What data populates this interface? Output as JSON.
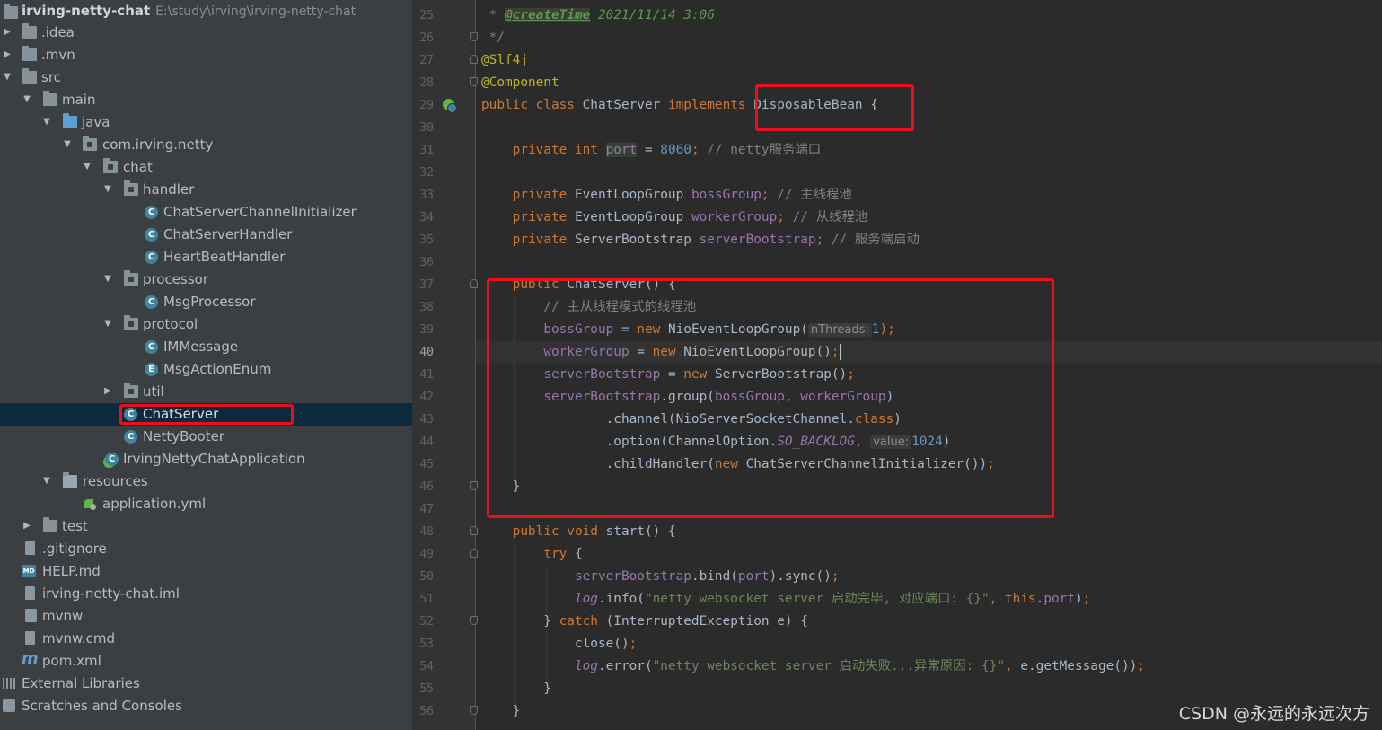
{
  "project_tree": {
    "root": {
      "name": "irving-netty-chat",
      "path": "E:\\study\\irving\\irving-netty-chat"
    },
    "items": [
      {
        "label": ".idea"
      },
      {
        "label": ".mvn"
      },
      {
        "label": "src"
      },
      {
        "label": "main"
      },
      {
        "label": "java"
      },
      {
        "label": "com.irving.netty"
      },
      {
        "label": "chat"
      },
      {
        "label": "handler"
      },
      {
        "label": "ChatServerChannelInitializer",
        "icon_letter": "C"
      },
      {
        "label": "ChatServerHandler",
        "icon_letter": "C"
      },
      {
        "label": "HeartBeatHandler",
        "icon_letter": "C"
      },
      {
        "label": "processor"
      },
      {
        "label": "MsgProcessor",
        "icon_letter": "C"
      },
      {
        "label": "protocol"
      },
      {
        "label": "IMMessage",
        "icon_letter": "C"
      },
      {
        "label": "MsgActionEnum",
        "icon_letter": "E"
      },
      {
        "label": "util"
      },
      {
        "label": "ChatServer",
        "icon_letter": "C"
      },
      {
        "label": "NettyBooter",
        "icon_letter": "C"
      },
      {
        "label": "IrvingNettyChatApplication",
        "icon_letter": "C"
      },
      {
        "label": "resources"
      },
      {
        "label": "application.yml"
      },
      {
        "label": "test"
      },
      {
        "label": ".gitignore"
      },
      {
        "label": "HELP.md",
        "icon_letter": "MD"
      },
      {
        "label": "irving-netty-chat.iml"
      },
      {
        "label": "mvnw"
      },
      {
        "label": "mvnw.cmd"
      },
      {
        "label": "pom.xml",
        "icon_letter": "m"
      },
      {
        "label": "External Libraries"
      },
      {
        "label": "Scratches and Consoles"
      }
    ]
  },
  "editor": {
    "current_line": 40,
    "line_numbers": [
      "25",
      "26",
      "27",
      "28",
      "29",
      "30",
      "31",
      "32",
      "33",
      "34",
      "35",
      "36",
      "37",
      "38",
      "39",
      "40",
      "41",
      "42",
      "43",
      "44",
      "45",
      "46",
      "47",
      "48",
      "49",
      "50",
      "51",
      "52",
      "53",
      "54",
      "55",
      "56"
    ],
    "code": {
      "l25": {
        "a": " * ",
        "b": "@createTime",
        "c": " 2021/11/14 3:06"
      },
      "l26": " */",
      "l27": "@Slf4j",
      "l28": "@Component",
      "l29": {
        "a": "public class ",
        "b": "ChatServer ",
        "c": "implements ",
        "d": "DisposableBean {"
      },
      "l31": {
        "a": "    private int ",
        "b": "port",
        "c": " = ",
        "d": "8060",
        "e": "; ",
        "f": "// netty服务端口"
      },
      "l33": {
        "a": "    private ",
        "b": "EventLoopGroup ",
        "c": "bossGroup",
        "d": "; ",
        "e": "// 主线程池"
      },
      "l34": {
        "a": "    private ",
        "b": "EventLoopGroup ",
        "c": "workerGroup",
        "d": "; ",
        "e": "// 从线程池"
      },
      "l35": {
        "a": "    private ",
        "b": "ServerBootstrap ",
        "c": "serverBootstrap",
        "d": "; ",
        "e": "// 服务端启动"
      },
      "l37": {
        "a": "    public ",
        "b": "ChatServer() {"
      },
      "l38": "        // 主从线程模式的线程池",
      "l39": {
        "a": "        ",
        "b": "bossGroup",
        "c": " = ",
        "d": "new ",
        "e": "NioEventLoopGroup(",
        "hint": "nThreads:",
        "f": "1",
        "g": ");"
      },
      "l40": {
        "a": "        ",
        "b": "workerGroup",
        "c": " = ",
        "d": "new ",
        "e": "NioEventLoopGroup()",
        "f": ";"
      },
      "l41": {
        "a": "        ",
        "b": "serverBootstrap",
        "c": " = ",
        "d": "new ",
        "e": "ServerBootstrap()",
        "f": ";"
      },
      "l42": {
        "a": "        ",
        "b": "serverBootstrap",
        "c": ".group(",
        "d": "bossGroup",
        "e": ", ",
        "f": "workerGroup",
        "g": ")"
      },
      "l43": {
        "a": "                .channel(NioServerSocketChannel.",
        "b": "class",
        "c": ")"
      },
      "l44": {
        "a": "                .option(ChannelOption.",
        "b": "SO_BACKLOG",
        "c": ", ",
        "hint": "value:",
        "d": "1024",
        "e": ")"
      },
      "l45": {
        "a": "                .childHandler(",
        "b": "new ",
        "c": "ChatServerChannelInitializer())",
        "d": ";"
      },
      "l46": "    }",
      "l48": {
        "a": "    public void ",
        "b": "start() {"
      },
      "l49": {
        "a": "        ",
        "b": "try ",
        "c": "{"
      },
      "l50": {
        "a": "            ",
        "b": "serverBootstrap",
        "c": ".bind(",
        "d": "port",
        "e": ").sync()",
        "f": ";"
      },
      "l51": {
        "a": "            ",
        "b": "log",
        "c": ".info(",
        "d": "\"netty websocket server 启动完毕, 对应端口: {}\"",
        "e": ", ",
        "f": "this",
        "g": ".",
        "h": "port",
        "i": ")",
        "j": ";"
      },
      "l52": {
        "a": "        } ",
        "b": "catch ",
        "c": "(InterruptedException e) {"
      },
      "l53": {
        "a": "            close()",
        "b": ";"
      },
      "l54": {
        "a": "            ",
        "b": "log",
        "c": ".error(",
        "d": "\"netty websocket server 启动失败...异常原因: {}\"",
        "e": ", ",
        "f": "e.getMessage())",
        "g": ";"
      },
      "l55": "        }",
      "l56": "    }"
    }
  },
  "colors": {
    "highlight_box": "#e8101a",
    "selection": "#0d293e"
  },
  "watermark": "CSDN @永远的永远次方"
}
